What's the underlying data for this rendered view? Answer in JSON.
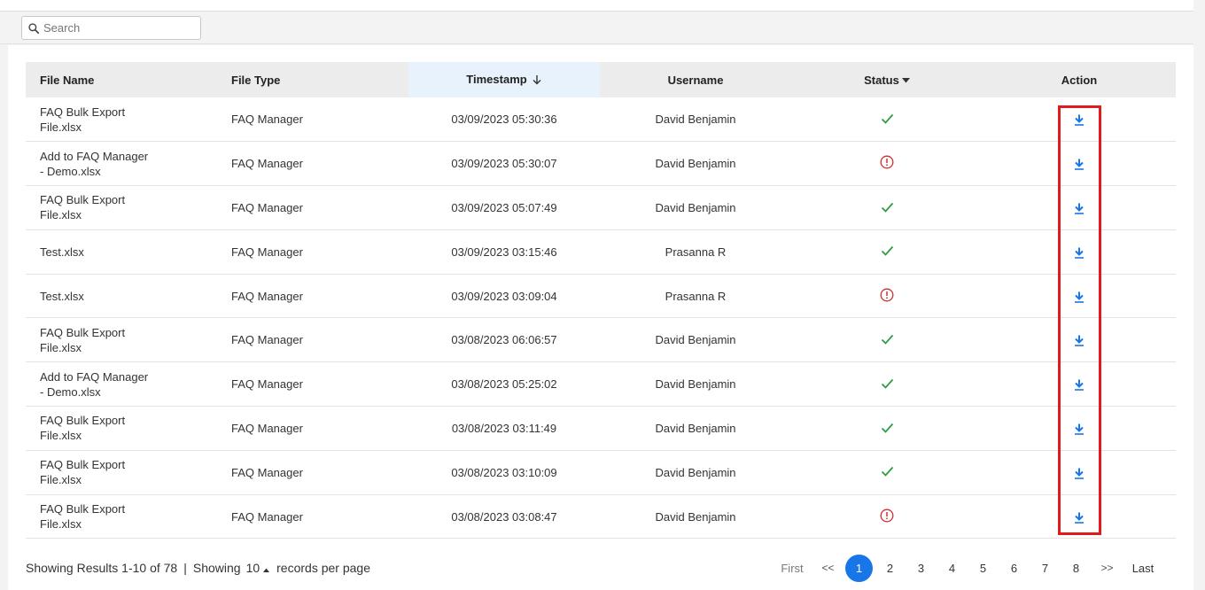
{
  "search": {
    "placeholder": "Search"
  },
  "table": {
    "headers": {
      "file_name": "File Name",
      "file_type": "File Type",
      "timestamp": "Timestamp",
      "username": "Username",
      "status": "Status",
      "action": "Action"
    },
    "rows": [
      {
        "file_name": "FAQ Bulk Export File.xlsx",
        "file_type": "FAQ Manager",
        "timestamp": "03/09/2023 05:30:36",
        "username": "David Benjamin",
        "status": "success"
      },
      {
        "file_name": "Add to FAQ Manager - Demo.xlsx",
        "file_type": "FAQ Manager",
        "timestamp": "03/09/2023 05:30:07",
        "username": "David Benjamin",
        "status": "error"
      },
      {
        "file_name": "FAQ Bulk Export File.xlsx",
        "file_type": "FAQ Manager",
        "timestamp": "03/09/2023 05:07:49",
        "username": "David Benjamin",
        "status": "success"
      },
      {
        "file_name": "Test.xlsx",
        "file_type": "FAQ Manager",
        "timestamp": "03/09/2023 03:15:46",
        "username": "Prasanna R",
        "status": "success"
      },
      {
        "file_name": "Test.xlsx",
        "file_type": "FAQ Manager",
        "timestamp": "03/09/2023 03:09:04",
        "username": "Prasanna R",
        "status": "error"
      },
      {
        "file_name": "FAQ Bulk Export File.xlsx",
        "file_type": "FAQ Manager",
        "timestamp": "03/08/2023 06:06:57",
        "username": "David Benjamin",
        "status": "success"
      },
      {
        "file_name": "Add to FAQ Manager - Demo.xlsx",
        "file_type": "FAQ Manager",
        "timestamp": "03/08/2023 05:25:02",
        "username": "David Benjamin",
        "status": "success"
      },
      {
        "file_name": "FAQ Bulk Export File.xlsx",
        "file_type": "FAQ Manager",
        "timestamp": "03/08/2023 03:11:49",
        "username": "David Benjamin",
        "status": "success"
      },
      {
        "file_name": "FAQ Bulk Export File.xlsx",
        "file_type": "FAQ Manager",
        "timestamp": "03/08/2023 03:10:09",
        "username": "David Benjamin",
        "status": "success"
      },
      {
        "file_name": "FAQ Bulk Export File.xlsx",
        "file_type": "FAQ Manager",
        "timestamp": "03/08/2023 03:08:47",
        "username": "David Benjamin",
        "status": "error"
      }
    ]
  },
  "footer": {
    "results_text": "Showing Results 1-10 of 78",
    "separator": "|",
    "showing_label": "Showing",
    "per_page_value": "10",
    "per_page_suffix": "records per page"
  },
  "pagination": {
    "first": "First",
    "prev": "<<",
    "pages": [
      "1",
      "2",
      "3",
      "4",
      "5",
      "6",
      "7",
      "8"
    ],
    "current": "1",
    "next": ">>",
    "last": "Last"
  },
  "icons": {
    "search": "search-icon",
    "sort_desc": "arrow-down-icon",
    "status_dropdown": "caret-down-icon",
    "success": "check-icon",
    "error": "error-circle-icon",
    "download": "download-icon"
  },
  "colors": {
    "accent": "#1976e8",
    "success": "#2e9b46",
    "error": "#d32f2f",
    "highlight": "#e11b1b",
    "sorted_header": "#e8f2fd"
  }
}
